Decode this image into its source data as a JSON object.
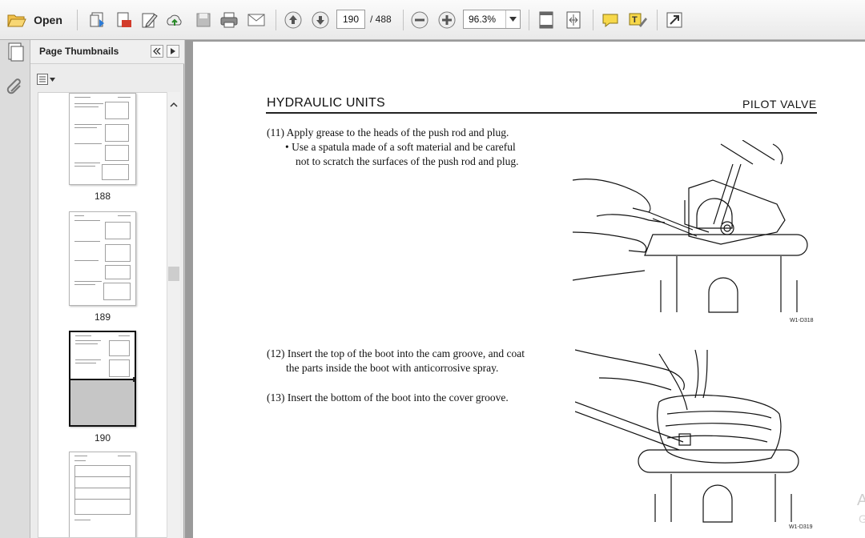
{
  "toolbar": {
    "open_label": "Open",
    "page_current": "190",
    "page_total": "/ 488",
    "zoom": "96.3%"
  },
  "nav": {
    "panel_title": "Page Thumbnails",
    "thumbnails": [
      {
        "label": "188"
      },
      {
        "label": "189"
      },
      {
        "label": "190"
      },
      {
        "label": ""
      }
    ]
  },
  "document": {
    "header_left": "HYDRAULIC UNITS",
    "header_right": "PILOT  VALVE",
    "step11_line1": "(11) Apply grease to the heads of the push rod and plug.",
    "step11_line2": "•  Use a spatula made of a soft material and be careful",
    "step11_line3": "not to scratch the surfaces of the push rod and plug.",
    "step12_line1": "(12) Insert the top of the boot into the cam groove, and coat",
    "step12_line2": "the parts inside the boot with anticorrosive spray.",
    "step13_line1": "(13) Insert the bottom of the boot into the cover groove.",
    "fig1_caption": "W1-D318",
    "fig2_caption": "W1-D319",
    "watermark_line1": "A",
    "watermark_line2": "G"
  }
}
